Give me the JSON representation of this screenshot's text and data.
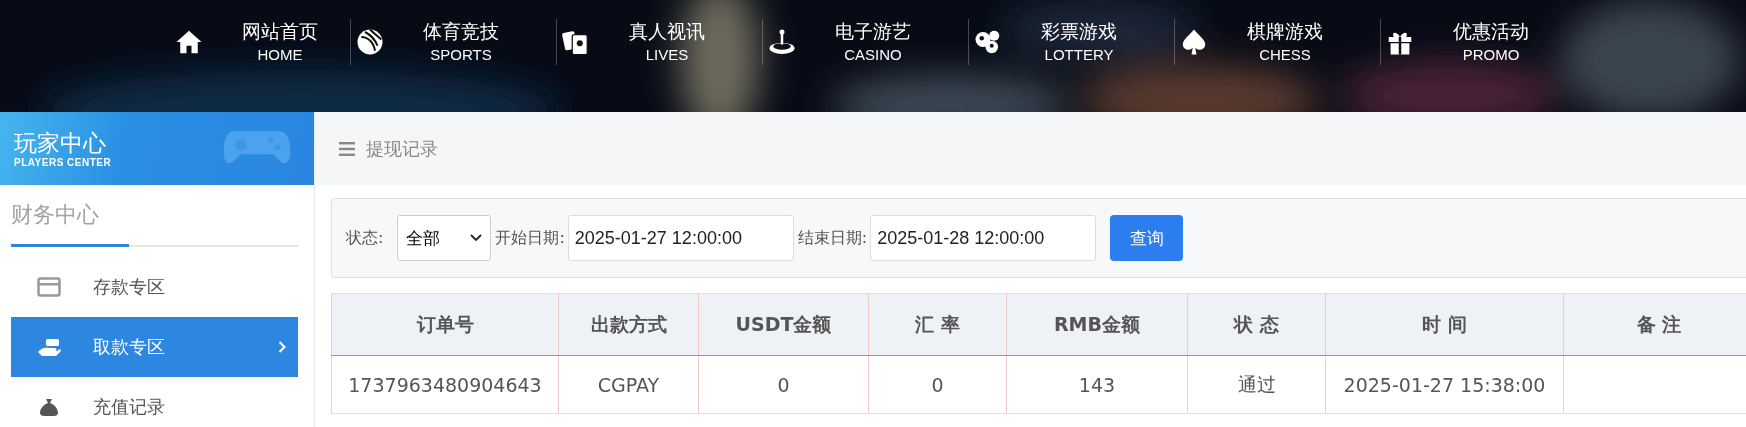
{
  "top_nav": [
    {
      "title": "网站首页",
      "subtitle": "HOME"
    },
    {
      "title": "体育竞技",
      "subtitle": "SPORTS"
    },
    {
      "title": "真人视讯",
      "subtitle": "LIVES"
    },
    {
      "title": "电子游艺",
      "subtitle": "CASINO"
    },
    {
      "title": "彩票游戏",
      "subtitle": "LOTTERY"
    },
    {
      "title": "棋牌游戏",
      "subtitle": "CHESS"
    },
    {
      "title": "优惠活动",
      "subtitle": "PROMO"
    }
  ],
  "sidebar": {
    "banner_title": "玩家中心",
    "banner_subtitle": "PLAYERS CENTER",
    "section_title": "财务中心",
    "items": [
      {
        "label": "存款专区",
        "selected": false
      },
      {
        "label": "取款专区",
        "selected": true
      },
      {
        "label": "充值记录",
        "selected": false
      }
    ]
  },
  "page_header": {
    "title": "提现记录"
  },
  "filters": {
    "status_label": "状态:",
    "status_value": "全部",
    "start_label": "开始日期:",
    "start_value": "2025-01-27 12:00:00",
    "end_label": "结束日期:",
    "end_value": "2025-01-28 12:00:00",
    "query_button": "查询"
  },
  "table": {
    "columns": [
      "订单号",
      "出款方式",
      "USDT金额",
      "汇 率",
      "RMB金额",
      "状 态",
      "时 间",
      "备 注"
    ],
    "rows": [
      [
        "1737963480904643",
        "CGPAY",
        "0",
        "0",
        "143",
        "通过",
        "2025-01-27 15:38:00",
        ""
      ]
    ]
  }
}
